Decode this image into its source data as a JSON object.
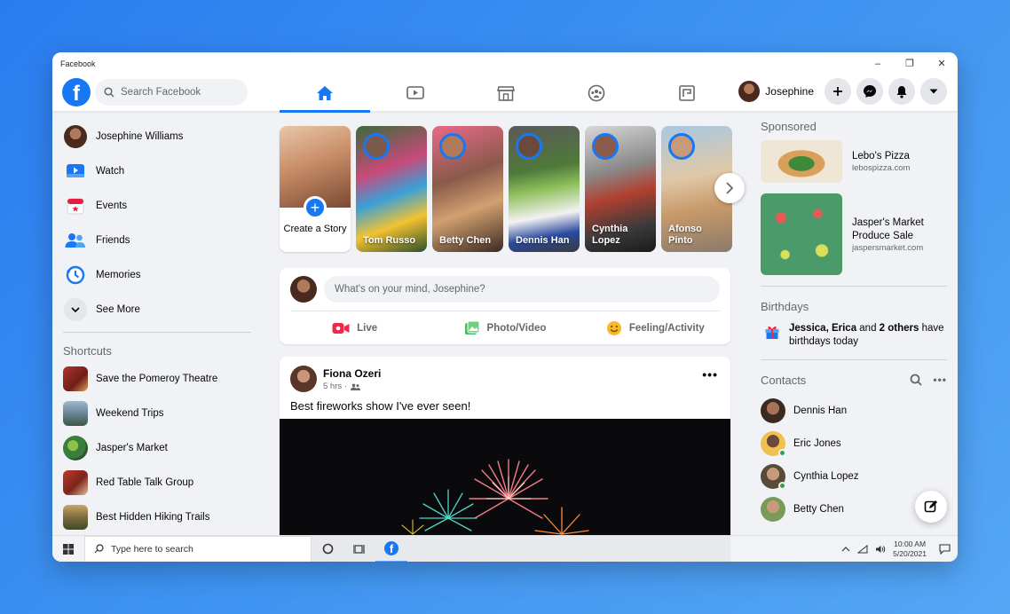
{
  "window": {
    "title": "Facebook",
    "controls": [
      "–",
      "❐",
      "✕"
    ]
  },
  "topnav": {
    "logo_letter": "f",
    "search_placeholder": "Search Facebook",
    "profile_name": "Josephine"
  },
  "left_menu": {
    "items": [
      {
        "label": "Josephine Williams",
        "icon": "avatar"
      },
      {
        "label": "Watch",
        "icon": "watch-icon"
      },
      {
        "label": "Events",
        "icon": "calendar-icon"
      },
      {
        "label": "Friends",
        "icon": "friends-icon"
      },
      {
        "label": "Memories",
        "icon": "clock-icon"
      },
      {
        "label": "See More",
        "icon": "chevron-down-icon"
      }
    ],
    "shortcuts_heading": "Shortcuts",
    "shortcuts": [
      {
        "label": "Save the Pomeroy Theatre"
      },
      {
        "label": "Weekend Trips"
      },
      {
        "label": "Jasper's Market"
      },
      {
        "label": "Red Table Talk Group"
      },
      {
        "label": "Best Hidden Hiking Trails"
      }
    ]
  },
  "stories": {
    "create_label": "Create a Story",
    "items": [
      {
        "name": "Tom Russo"
      },
      {
        "name": "Betty Chen"
      },
      {
        "name": "Dennis Han"
      },
      {
        "name": "Cynthia Lopez"
      },
      {
        "name": "Afonso Pinto"
      }
    ]
  },
  "composer": {
    "placeholder": "What's on your mind, Josephine?",
    "live": "Live",
    "photo": "Photo/Video",
    "feeling": "Feeling/Activity"
  },
  "post": {
    "author": "Fiona Ozeri",
    "time": "5 hrs ·",
    "text": "Best fireworks show I've ever seen!"
  },
  "right": {
    "sponsored_heading": "Sponsored",
    "ads": [
      {
        "title": "Lebo's Pizza",
        "url": "lebospizza.com"
      },
      {
        "title": "Jasper's Market Produce Sale",
        "url": "jaspersmarket.com"
      }
    ],
    "birthdays_heading": "Birthdays",
    "birthday_names": "Jessica, Erica",
    "birthday_and": " and ",
    "birthday_others": "2 others",
    "birthday_rest": " have birthdays today",
    "contacts_heading": "Contacts",
    "contacts": [
      {
        "name": "Dennis Han"
      },
      {
        "name": "Eric Jones"
      },
      {
        "name": "Cynthia Lopez"
      },
      {
        "name": "Betty Chen"
      }
    ]
  },
  "taskbar": {
    "search_placeholder": "Type here to search",
    "time": "10:00 AM",
    "date": "5/20/2021"
  }
}
